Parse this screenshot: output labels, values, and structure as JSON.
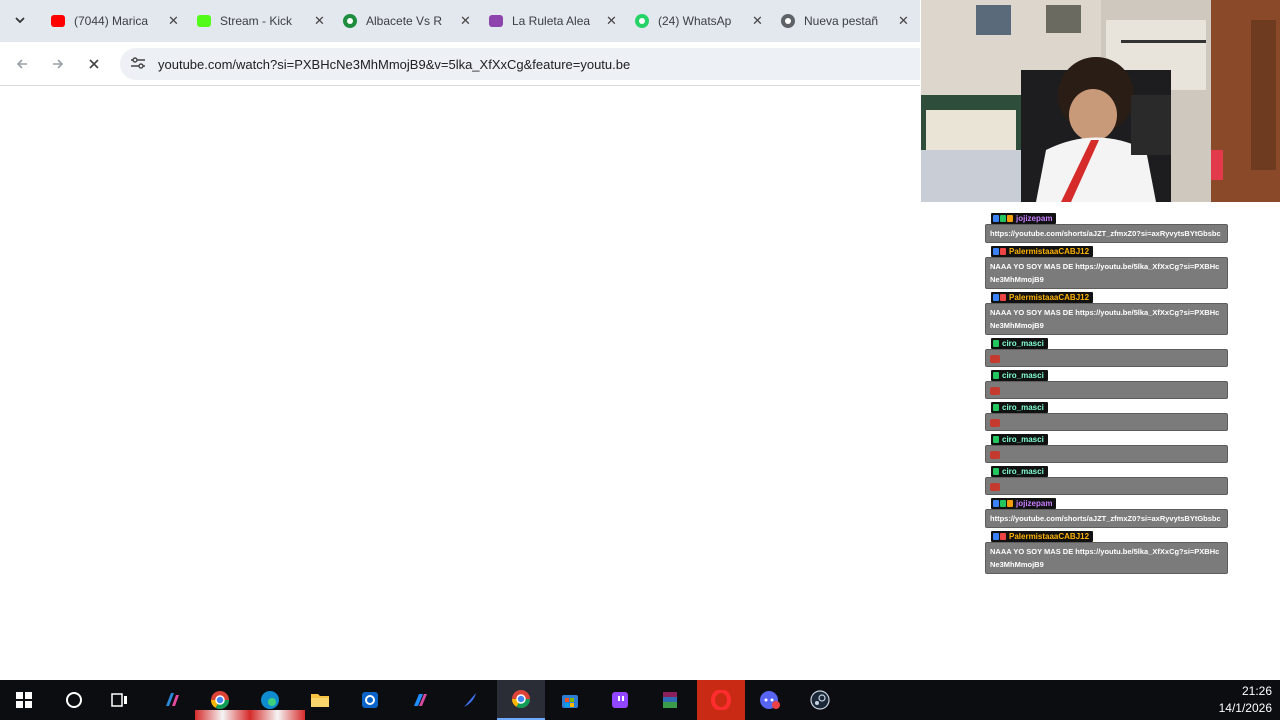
{
  "browser": {
    "tabs": [
      {
        "title": "(7044) Marica",
        "favicon": "youtube-icon",
        "color": "#ff0000"
      },
      {
        "title": "Stream - Kick",
        "favicon": "kick-icon",
        "color": "#53fc18"
      },
      {
        "title": "Albacete Vs R",
        "favicon": "soccer-icon",
        "color": "#1e8e3e"
      },
      {
        "title": "La Ruleta Alea",
        "favicon": "wheel-icon",
        "color": "#8e44ad"
      },
      {
        "title": "(24) WhatsAp",
        "favicon": "whatsapp-icon",
        "color": "#25d366"
      },
      {
        "title": "Nueva pestañ",
        "favicon": "chrome-icon",
        "color": "#5f6368"
      }
    ],
    "url": "youtube.com/watch?si=PXBHcNe3MhMmojB9&v=5lka_XfXxCg&feature=youtu.be"
  },
  "chat": {
    "messages": [
      {
        "user": "jojizepam",
        "user_color": "#c77dff",
        "text": "https://youtube.com/shorts/aJZT_zfmxZ0?si=axRyvytsBYtGbsbc",
        "emote": false
      },
      {
        "user": "PalermistaaaCABJ12",
        "user_color": "#ffb300",
        "text": "NAAA YO SOY MAS DE https://youtu.be/5lka_XfXxCg?si=PXBHcNe3MhMmojB9",
        "emote": false
      },
      {
        "user": "PalermistaaaCABJ12",
        "user_color": "#ffb300",
        "text": "NAAA YO SOY MAS DE https://youtu.be/5lka_XfXxCg?si=PXBHcNe3MhMmojB9",
        "emote": false
      },
      {
        "user": "ciro_masci",
        "user_color": "#7fffd4",
        "text": "",
        "emote": true
      },
      {
        "user": "ciro_masci",
        "user_color": "#7fffd4",
        "text": "",
        "emote": true
      },
      {
        "user": "ciro_masci",
        "user_color": "#7fffd4",
        "text": "",
        "emote": true
      },
      {
        "user": "ciro_masci",
        "user_color": "#7fffd4",
        "text": "",
        "emote": true
      },
      {
        "user": "ciro_masci",
        "user_color": "#7fffd4",
        "text": "",
        "emote": true
      },
      {
        "user": "jojizepam",
        "user_color": "#c77dff",
        "text": "https://youtube.com/shorts/aJZT_zfmxZ0?si=axRyvytsBYtGbsbc",
        "emote": false
      },
      {
        "user": "PalermistaaaCABJ12",
        "user_color": "#ffb300",
        "text": "NAAA YO SOY MAS DE https://youtu.be/5lka_XfXxCg?si=PXBHcNe3MhMmojB9",
        "emote": false
      }
    ]
  },
  "taskbar": {
    "time": "21:26",
    "date": "14/1/2026"
  }
}
